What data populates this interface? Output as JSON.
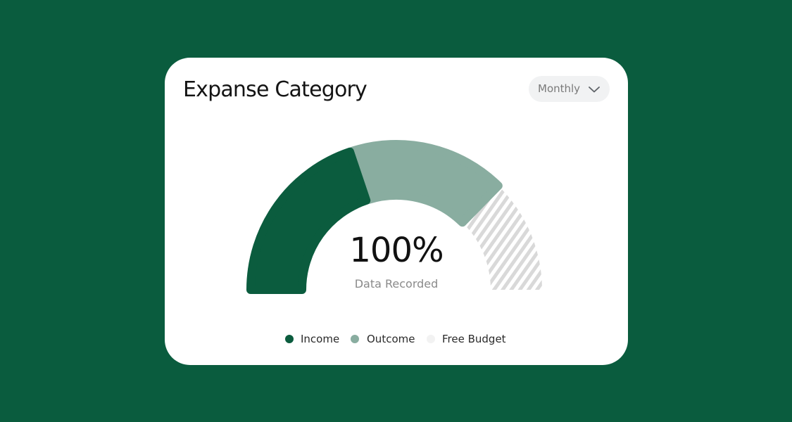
{
  "colors": {
    "background": "#0a5c3e",
    "card": "#ffffff",
    "income": "#0b5c3e",
    "outcome": "#89ada0",
    "free_budget": "#f2f2f2",
    "hatch": "#d9d9d9"
  },
  "card": {
    "title": "Expanse Category",
    "period": {
      "selected": "Monthly",
      "icon": "chevron-down-icon"
    }
  },
  "gauge": {
    "center_value": "100%",
    "center_label": "Data Recorded"
  },
  "legend": [
    {
      "label": "Income",
      "color": "#0b5c3e"
    },
    {
      "label": "Outcome",
      "color": "#89ada0"
    },
    {
      "label": "Free Budget",
      "color": "#f2f2f2"
    }
  ],
  "chart_data": {
    "type": "pie",
    "shape": "semi-donut gauge",
    "categories": [
      "Income",
      "Outcome",
      "Free Budget"
    ],
    "values": [
      40,
      35,
      25
    ],
    "units": "percent of gauge (estimated)",
    "center_value": "100%",
    "center_label": "Data Recorded",
    "legend_position": "bottom"
  }
}
